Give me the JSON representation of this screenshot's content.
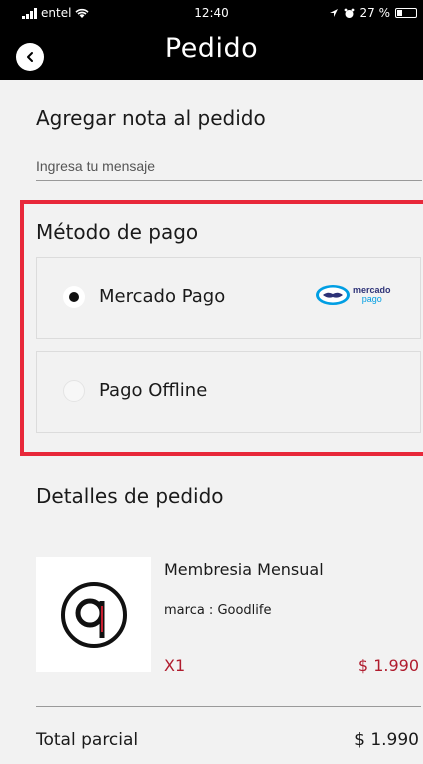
{
  "status_bar": {
    "carrier": "entel",
    "time": "12:40",
    "battery": "27 %"
  },
  "header": {
    "title": "Pedido"
  },
  "note": {
    "title": "Agregar nota al pedido",
    "placeholder": "Ingresa tu mensaje"
  },
  "payment": {
    "title": "Método de pago",
    "options": [
      {
        "label": "Mercado Pago",
        "selected": true,
        "logo_line1": "mercado",
        "logo_line2": "pago"
      },
      {
        "label": "Pago Offline",
        "selected": false
      }
    ],
    "highlight_color": "#e8283a"
  },
  "details": {
    "title": "Detalles de pedido",
    "items": [
      {
        "name": "Membresia Mensual",
        "brand": "marca : Goodlife",
        "qty": "X1",
        "price": "$ 1.990"
      }
    ],
    "subtotal_label": "Total parcial",
    "subtotal_value": "$ 1.990"
  },
  "colors": {
    "accent_red": "#b01c2e",
    "header_bg": "#000000"
  }
}
